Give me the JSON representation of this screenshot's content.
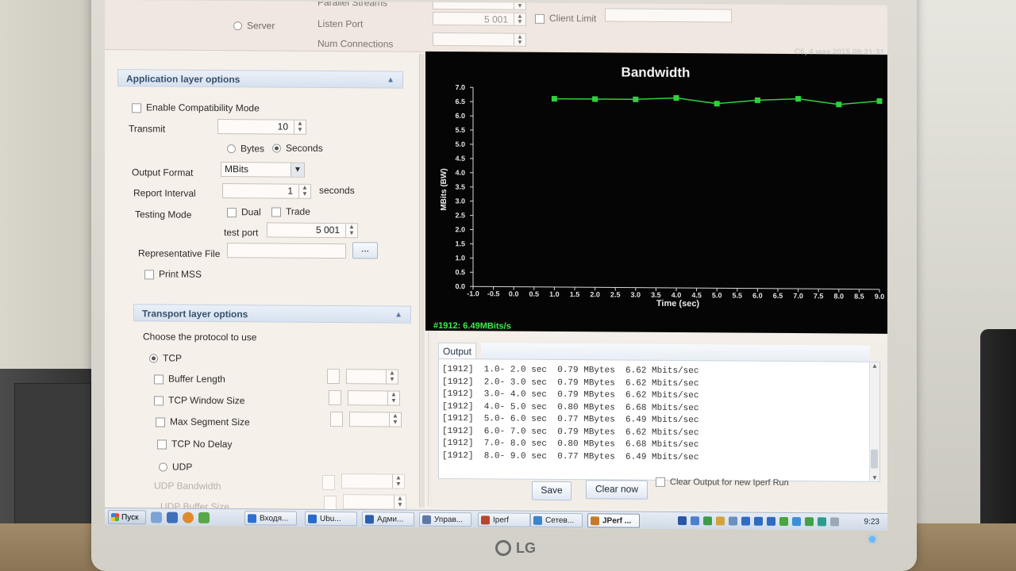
{
  "environment": {
    "monitor_brand": "LG"
  },
  "top_panel": {
    "server_label": "Server",
    "parallel_streams_label": "Parallel Streams",
    "listen_port_label": "Listen Port",
    "listen_port_value": "5 001",
    "client_limit_label": "Client Limit",
    "max_connections_label": "Num Connections"
  },
  "app_layer": {
    "header": "Application layer options",
    "compat_mode_label": "Enable Compatibility Mode",
    "transmit_label": "Transmit",
    "transmit_value": "10",
    "bytes_label": "Bytes",
    "seconds_label": "Seconds",
    "output_format_label": "Output Format",
    "output_format_value": "MBits",
    "report_interval_label": "Report Interval",
    "report_interval_value": "1",
    "report_interval_unit": "seconds",
    "testing_mode_label": "Testing Mode",
    "dual_label": "Dual",
    "trade_label": "Trade",
    "test_port_label": "test port",
    "test_port_value": "5 001",
    "rep_file_label": "Representative File",
    "rep_file_button": "...",
    "print_mss_label": "Print MSS"
  },
  "transport_layer": {
    "header": "Transport layer options",
    "choose_protocol_label": "Choose the protocol to use",
    "tcp_label": "TCP",
    "buffer_length_label": "Buffer Length",
    "tcp_window_label": "TCP Window Size",
    "max_segment_label": "Max Segment Size",
    "tcp_no_delay_label": "TCP No Delay",
    "udp_label": "UDP",
    "udp_bandwidth_label": "UDP Bandwidth",
    "udp_buffer_label": "UDP Buffer Size"
  },
  "chart_data": {
    "type": "line",
    "title": "Bandwidth",
    "xlabel": "Time (sec)",
    "ylabel": "MBits (BW)",
    "datestamp": "C6, 4 мая 2015 09:21:31",
    "xlim": [
      -1.0,
      9.0
    ],
    "ylim": [
      0.0,
      7.0
    ],
    "x_ticks": [
      "-1.0",
      "-0.5",
      "0.0",
      "0.5",
      "1.0",
      "1.5",
      "2.0",
      "2.5",
      "3.0",
      "3.5",
      "4.0",
      "4.5",
      "5.0",
      "5.5",
      "6.0",
      "6.5",
      "7.0",
      "7.5",
      "8.0",
      "8.5",
      "9.0"
    ],
    "y_ticks": [
      "0.0",
      "0.5",
      "1.0",
      "1.5",
      "2.0",
      "2.5",
      "3.0",
      "3.5",
      "4.0",
      "4.5",
      "5.0",
      "5.5",
      "6.0",
      "6.5",
      "7.0"
    ],
    "grid": false,
    "line_color": "#2fd23c",
    "series": [
      {
        "x": [
          1.0,
          2.0,
          3.0,
          4.0,
          5.0,
          6.0,
          7.0,
          8.0,
          9.0
        ],
        "values": [
          6.62,
          6.62,
          6.62,
          6.68,
          6.49,
          6.62,
          6.68,
          6.49,
          6.62
        ]
      }
    ],
    "status": "#1912: 6.49MBits/s"
  },
  "output": {
    "tab_label": "Output",
    "lines": [
      "[1912]  1.0- 2.0 sec  0.79 MBytes  6.62 Mbits/sec",
      "[1912]  2.0- 3.0 sec  0.79 MBytes  6.62 Mbits/sec",
      "[1912]  3.0- 4.0 sec  0.79 MBytes  6.62 Mbits/sec",
      "[1912]  4.0- 5.0 sec  0.80 MBytes  6.68 Mbits/sec",
      "[1912]  5.0- 6.0 sec  0.77 MBytes  6.49 Mbits/sec",
      "[1912]  6.0- 7.0 sec  0.79 MBytes  6.62 Mbits/sec",
      "[1912]  7.0- 8.0 sec  0.80 MBytes  6.68 Mbits/sec",
      "[1912]  8.0- 9.0 sec  0.77 MBytes  6.49 Mbits/sec"
    ],
    "save_label": "Save",
    "clear_label": "Clear now",
    "clear_on_run_label": "Clear Output for new Iperf Run"
  },
  "taskbar": {
    "start_label": "Пуск",
    "tasks": [
      {
        "label": "Входя...",
        "color": "#2f6fd0"
      },
      {
        "label": "Ubu...",
        "color": "#2a6ac8"
      },
      {
        "label": "Адми...",
        "color": "#2c5fae"
      },
      {
        "label": "Управ...",
        "color": "#5e7aa4"
      },
      {
        "label": "Iperf",
        "color": "#b8452c"
      },
      {
        "label": "Сетев...",
        "color": "#3d84c9"
      },
      {
        "label": "JPerf ...",
        "color": "#c77a2a"
      }
    ],
    "clock": "9:23"
  }
}
